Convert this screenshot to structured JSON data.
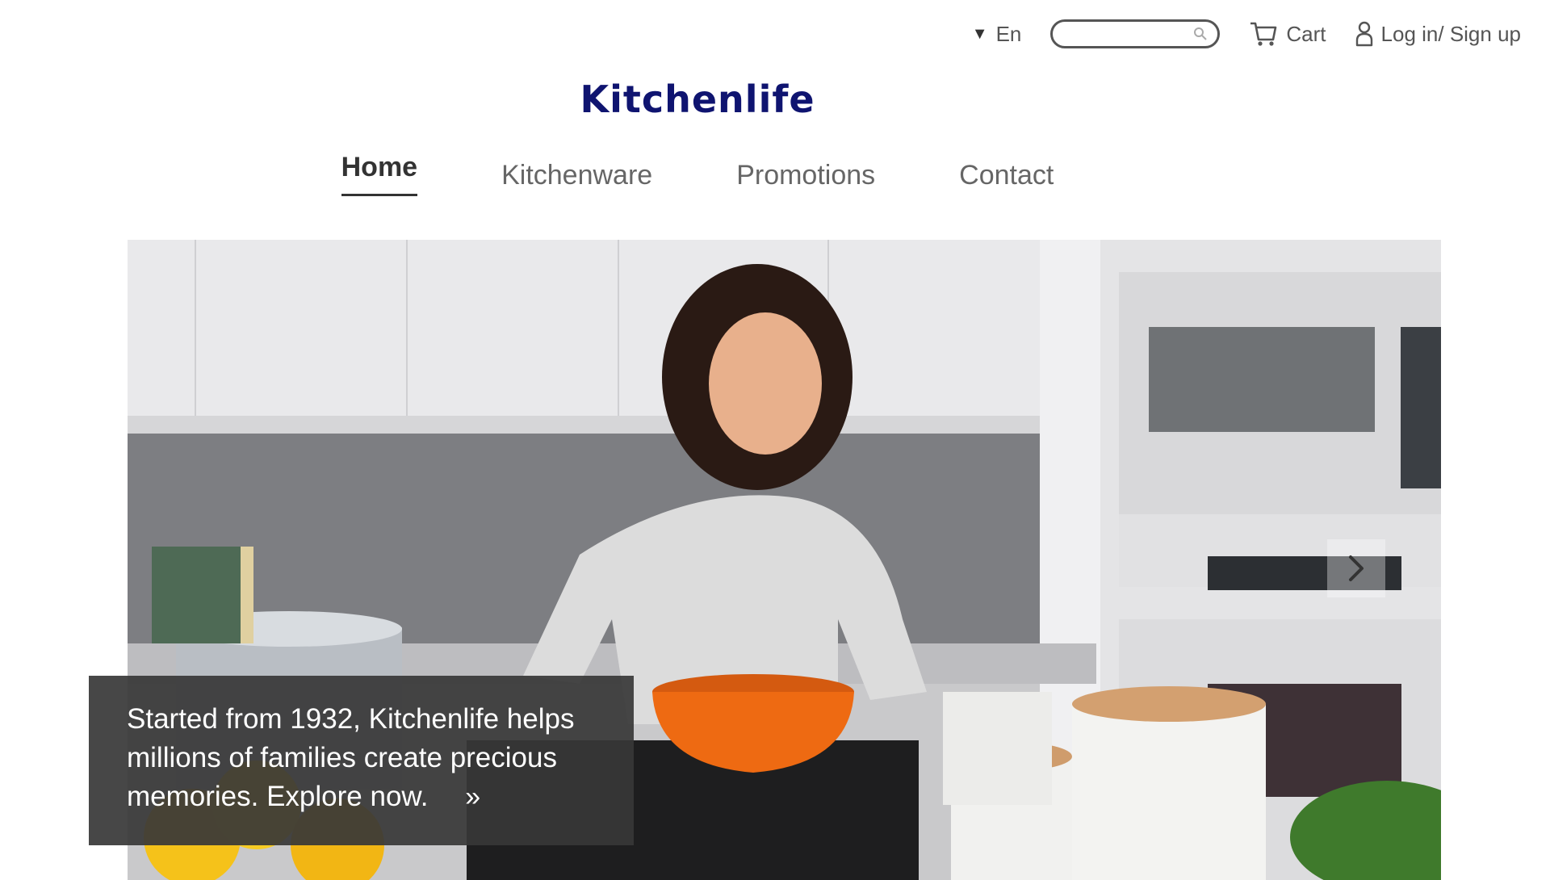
{
  "header": {
    "language": "En",
    "search_placeholder": "",
    "cart_label": "Cart",
    "login_label": "Log in/ Sign up"
  },
  "logo": {
    "text": "Kitchenlife",
    "color": "#0f1470"
  },
  "nav": {
    "items": [
      {
        "label": "Home",
        "active": true
      },
      {
        "label": "Kitchenware",
        "active": false
      },
      {
        "label": "Promotions",
        "active": false
      },
      {
        "label": "Contact",
        "active": false
      }
    ]
  },
  "hero": {
    "caption": "Started from 1932, Kitchenlife helps millions of families create precious memories. Explore now.",
    "more_glyph": "»",
    "next_icon": "chevron-right-icon"
  },
  "icons": {
    "language": "triangle-down-icon",
    "search": "magnifier-icon",
    "cart": "cart-icon",
    "login": "user-icon"
  }
}
